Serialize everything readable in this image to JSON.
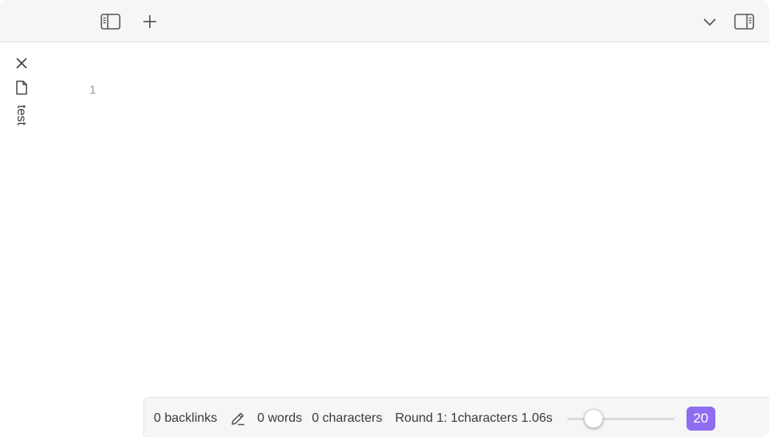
{
  "titlebar": {
    "left_buttons": [
      "sidebar-left-icon",
      "plus-icon"
    ],
    "right_buttons": [
      "chevron-down-icon",
      "sidebar-right-icon"
    ]
  },
  "tabs": {
    "active": {
      "title": "test",
      "icon": "file-icon",
      "close_icon": "close-icon"
    }
  },
  "editor": {
    "line_numbers": [
      "1"
    ],
    "content": ""
  },
  "statusbar": {
    "backlinks": "0 backlinks",
    "edit_icon": "pencil-icon",
    "words": "0 words",
    "characters": "0 characters",
    "round_status": "Round 1: 1characters 1.06s",
    "slider_level": 0.25,
    "badge_value": "20",
    "accent_color": "#8f6df0"
  }
}
